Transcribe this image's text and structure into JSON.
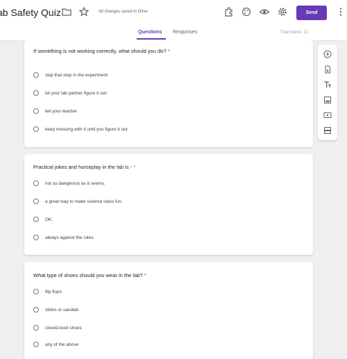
{
  "header": {
    "title": "ab Safety Quiz",
    "saved_status": "All changes saved in Drive",
    "send_label": "Send"
  },
  "tabs": [
    {
      "label": "Questions"
    },
    {
      "label": "Responses"
    }
  ],
  "total_points": "Total points: 21",
  "questions": [
    {
      "text": "If something is not working correctly, what should you do?",
      "required": "*",
      "options": [
        "skip that step in the experiment",
        "let your lab partner figure it out",
        "tell your teacher",
        "keep messing with it until you figure it out"
      ]
    },
    {
      "text": "Practical jokes and horseplay in the lab is -",
      "required": "*",
      "options": [
        "not as dangerous as it seems.",
        "a great way to make science class fun.",
        "OK.",
        "always against the rules."
      ]
    },
    {
      "text": "What type of shoes should you wear in the lab?",
      "required": "*",
      "options": [
        "flip flops",
        "slides or sandals",
        "closed-toed shoes",
        "any of the above"
      ]
    }
  ],
  "colors": {
    "accent": "#673ab7",
    "required": "#d93025"
  }
}
